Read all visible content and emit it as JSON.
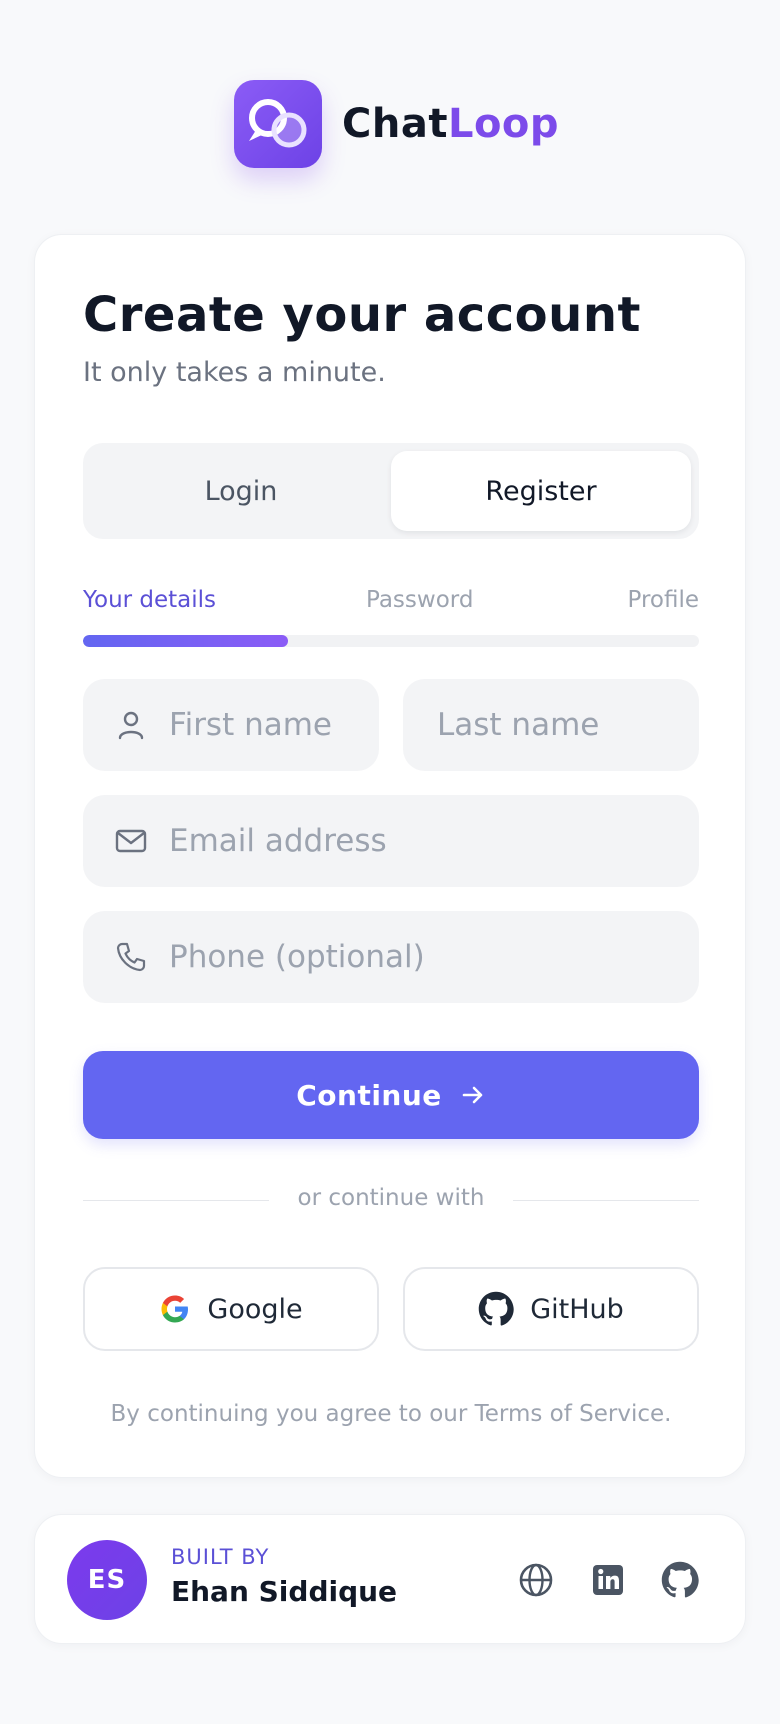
{
  "brand": {
    "name_part1": "Chat",
    "name_part2": "Loop",
    "logo_icon": "chat-bubbles-icon",
    "accent": "#7c4bea"
  },
  "card": {
    "title": "Create your account",
    "subtitle": "It only takes a minute."
  },
  "auth_toggle": {
    "login_label": "Login",
    "register_label": "Register",
    "selected": "Register"
  },
  "steps": {
    "items": [
      "Your details",
      "Password",
      "Profile"
    ],
    "current": 1,
    "progress_fraction": 0.333
  },
  "form": {
    "first_name": {
      "value": "",
      "placeholder": "First name",
      "icon": "user-icon"
    },
    "last_name": {
      "value": "",
      "placeholder": "Last name"
    },
    "email": {
      "value": "",
      "placeholder": "Email address",
      "icon": "mail-icon"
    },
    "phone": {
      "value": "",
      "placeholder": "Phone (optional)",
      "icon": "phone-icon"
    }
  },
  "continue_button": {
    "label": "Continue",
    "icon": "arrow-right-icon",
    "color": "#6366f1"
  },
  "divider_text": "or continue with",
  "social": {
    "google_label": "Google",
    "github_label": "GitHub"
  },
  "terms_text": "By continuing you agree to our Terms of Service.",
  "footer": {
    "avatar_initials": "ES",
    "built_by_label": "BUILT BY",
    "author_name": "Ehan Siddique",
    "links": [
      "globe-icon",
      "linkedin-icon",
      "github-icon"
    ]
  }
}
